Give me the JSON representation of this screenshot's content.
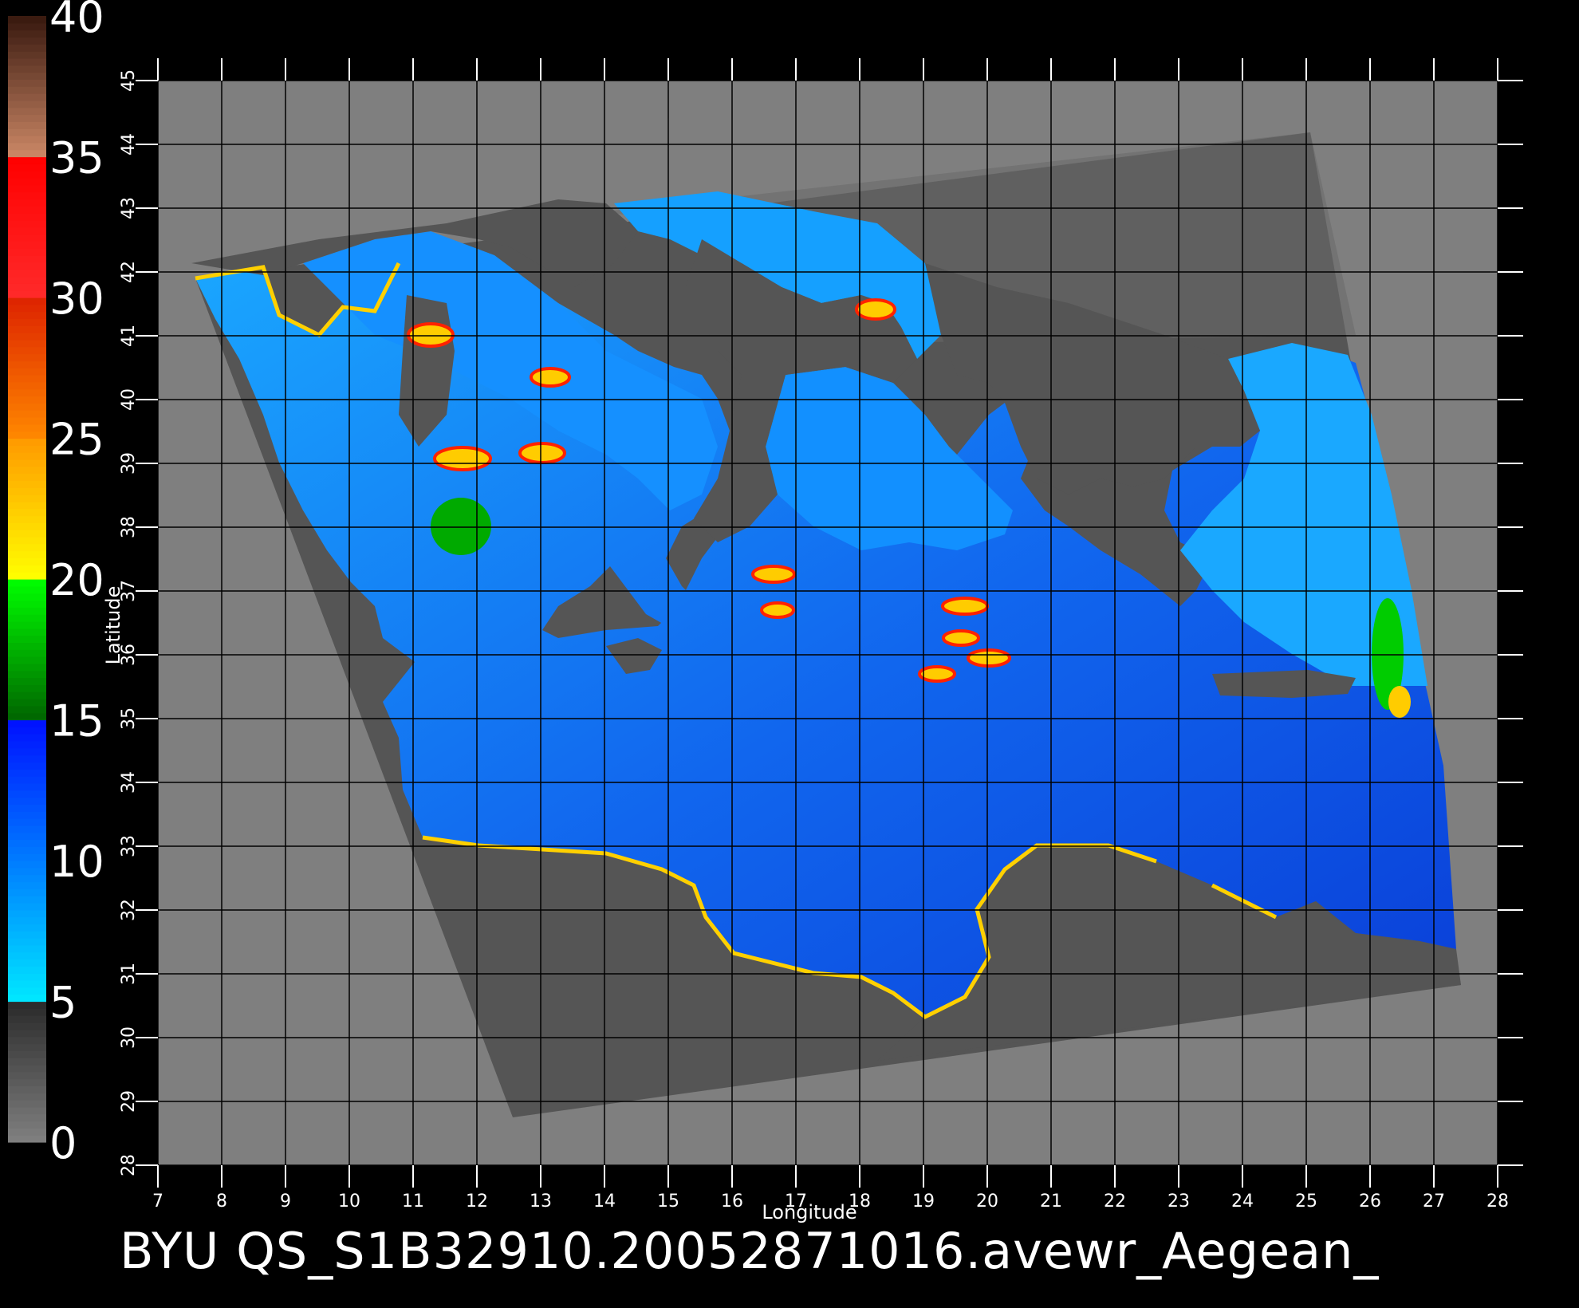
{
  "map": {
    "x_axis_title": "Longitude",
    "y_axis_title": "Latitude",
    "lon_ticks": [
      "7",
      "8",
      "9",
      "10",
      "11",
      "12",
      "13",
      "14",
      "15",
      "16",
      "17",
      "18",
      "19",
      "20",
      "21",
      "22",
      "23",
      "24",
      "25",
      "26",
      "27",
      "28"
    ],
    "lat_ticks": [
      "28",
      "29",
      "30",
      "31",
      "32",
      "33",
      "34",
      "35",
      "36",
      "37",
      "38",
      "39",
      "40",
      "41",
      "42",
      "43",
      "44",
      "45"
    ],
    "lon_range": [
      7,
      28
    ],
    "lat_range": [
      28,
      45
    ],
    "grid": true,
    "colors": {
      "background": "#000000",
      "land": "#555555",
      "outside_swath": "#7f7f7f",
      "grid": "#000000",
      "tick": "#ffffff"
    }
  },
  "colorbar": {
    "labels": [
      "0",
      "5",
      "10",
      "15",
      "20",
      "25",
      "30",
      "35",
      "40"
    ],
    "range": [
      0,
      40
    ],
    "stops": [
      {
        "value": 0,
        "color": "#808080"
      },
      {
        "value": 5,
        "color": "#2a2a2a"
      },
      {
        "value": 5.01,
        "color": "#00e8ff"
      },
      {
        "value": 15,
        "color": "#0010ff"
      },
      {
        "value": 15.01,
        "color": "#006400"
      },
      {
        "value": 20,
        "color": "#00ff00"
      },
      {
        "value": 20.01,
        "color": "#ffff00"
      },
      {
        "value": 25,
        "color": "#ff9900"
      },
      {
        "value": 25.01,
        "color": "#ff8800"
      },
      {
        "value": 30,
        "color": "#dd2200"
      },
      {
        "value": 30.01,
        "color": "#ff2a2a"
      },
      {
        "value": 35,
        "color": "#ff0000"
      },
      {
        "value": 35.01,
        "color": "#cc8866"
      },
      {
        "value": 39.9,
        "color": "#3a1a10"
      },
      {
        "value": 40,
        "color": "#ff00ff"
      }
    ]
  },
  "caption": "BYU QS_S1B32910.20052871016.avewr_Aegean_"
}
